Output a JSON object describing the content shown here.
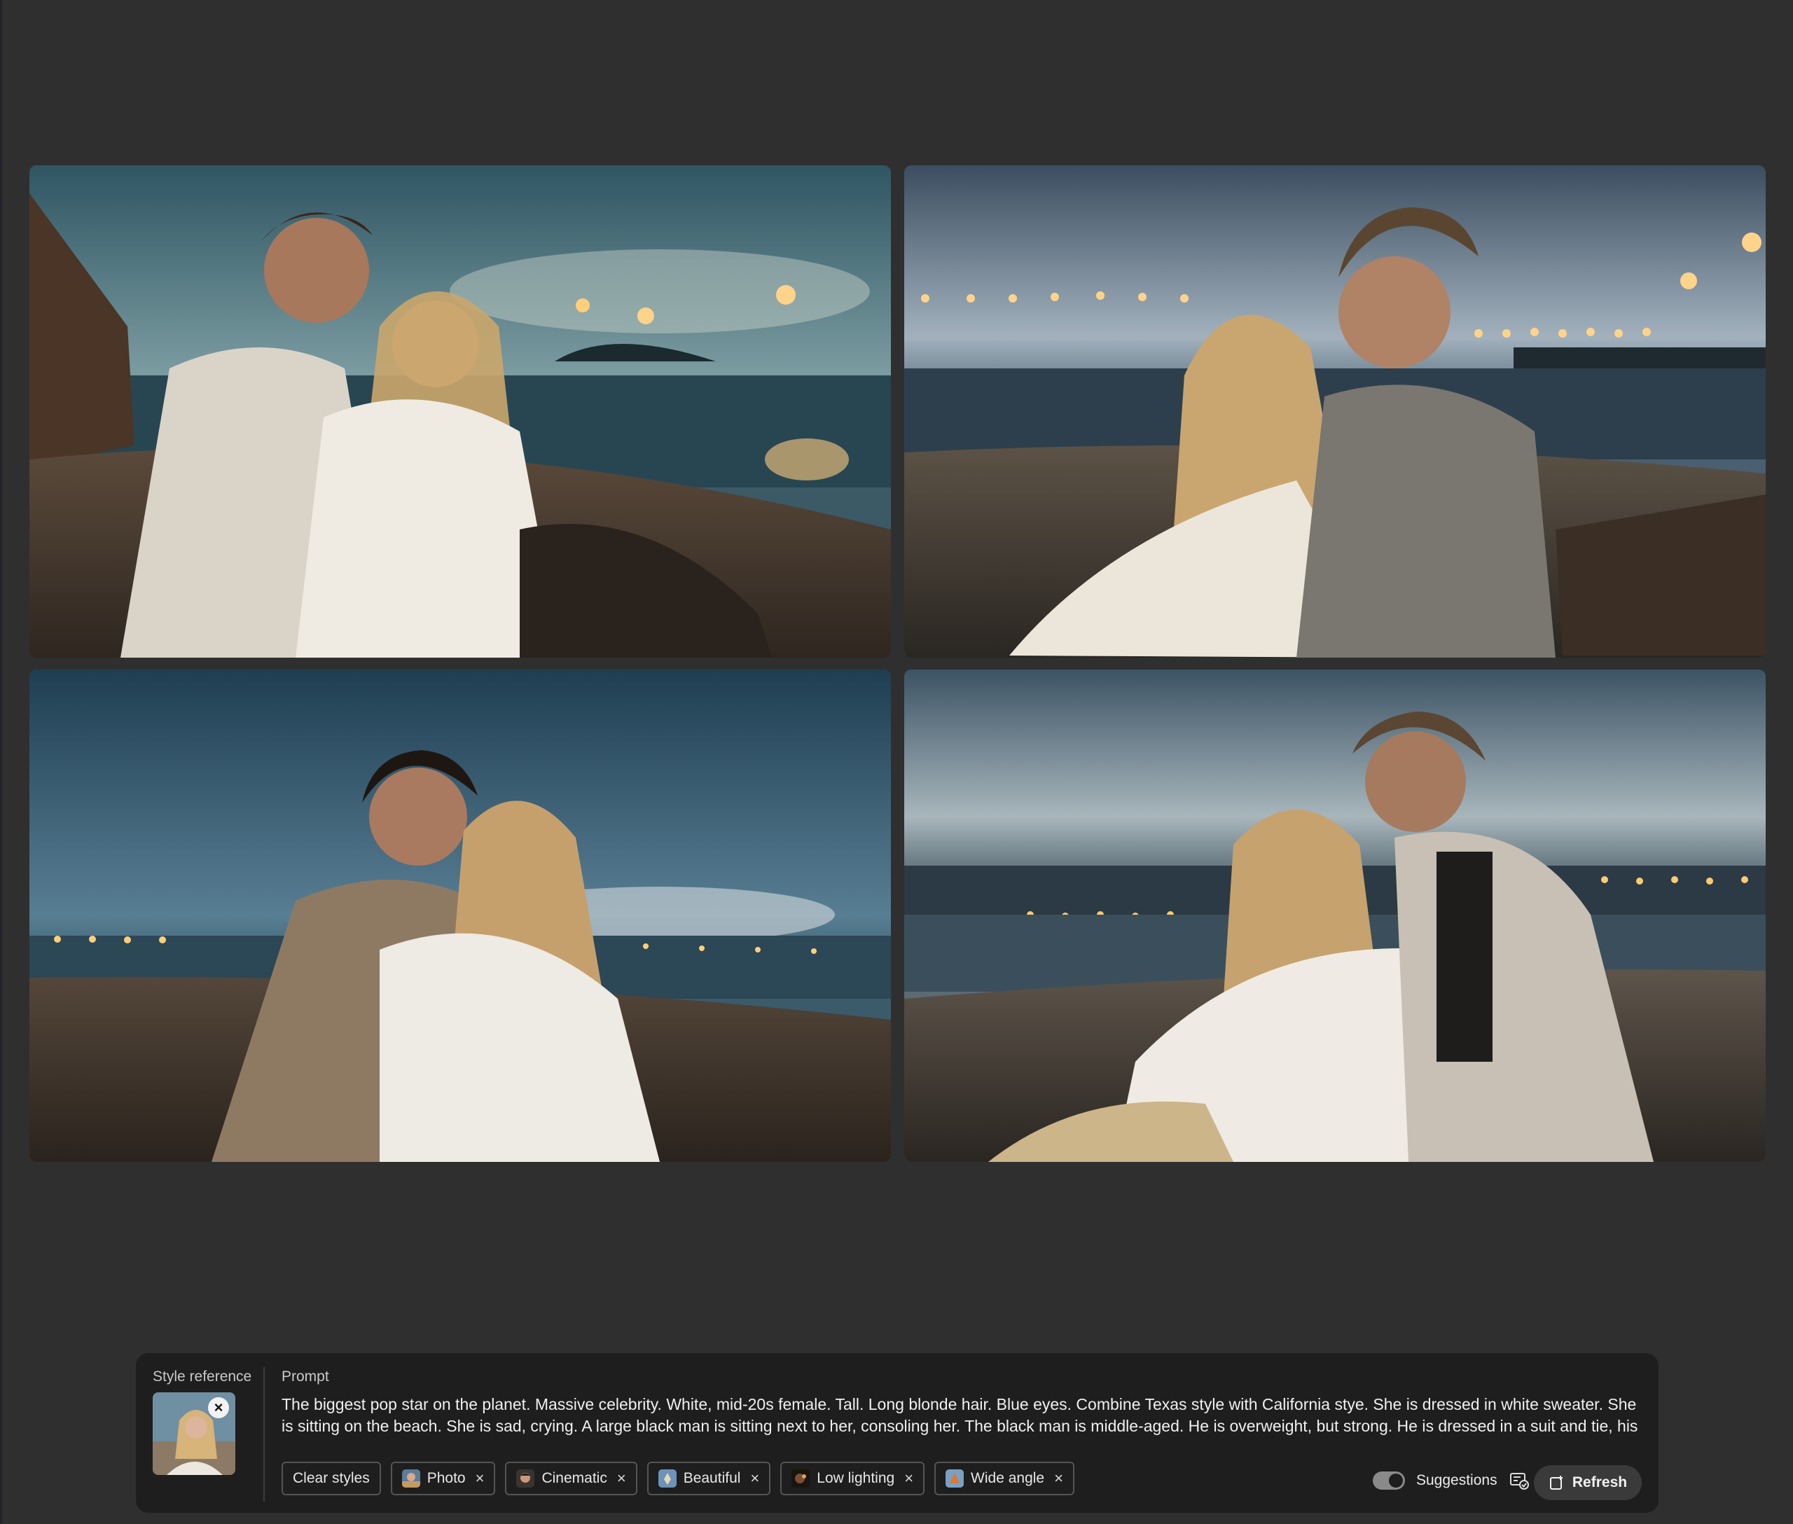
{
  "images": [
    {
      "name": "generated-image-1"
    },
    {
      "name": "generated-image-2"
    },
    {
      "name": "generated-image-3"
    },
    {
      "name": "generated-image-4"
    }
  ],
  "panel": {
    "style_reference_label": "Style reference",
    "prompt_label": "Prompt",
    "prompt_text": "The biggest pop star on the planet. Massive celebrity. White, mid-20s female. Tall. Long blonde hair. Blue eyes. Combine Texas style with California stye. She is dressed in white sweater. She is sitting on the beach. She is sad, crying. A large black man is sitting next to her, consoling her. The black man is middle-aged. He is overweight, but strong. He is dressed in a suit and tie, his collar",
    "clear_styles_label": "Clear styles",
    "chips": [
      {
        "label": "Photo",
        "icon": "photo-style-icon"
      },
      {
        "label": "Cinematic",
        "icon": "cinematic-style-icon"
      },
      {
        "label": "Beautiful",
        "icon": "beautiful-style-icon"
      },
      {
        "label": "Low lighting",
        "icon": "low-lighting-style-icon"
      },
      {
        "label": "Wide angle",
        "icon": "wide-angle-style-icon"
      }
    ],
    "chip_remove": "×",
    "suggestions_label": "Suggestions",
    "suggestions_on": true,
    "refresh_label": "Refresh",
    "remove_reference": "×"
  },
  "colors": {
    "background": "#2f2f2f",
    "panel": "#1e1e1e",
    "chip_border": "#545454"
  }
}
